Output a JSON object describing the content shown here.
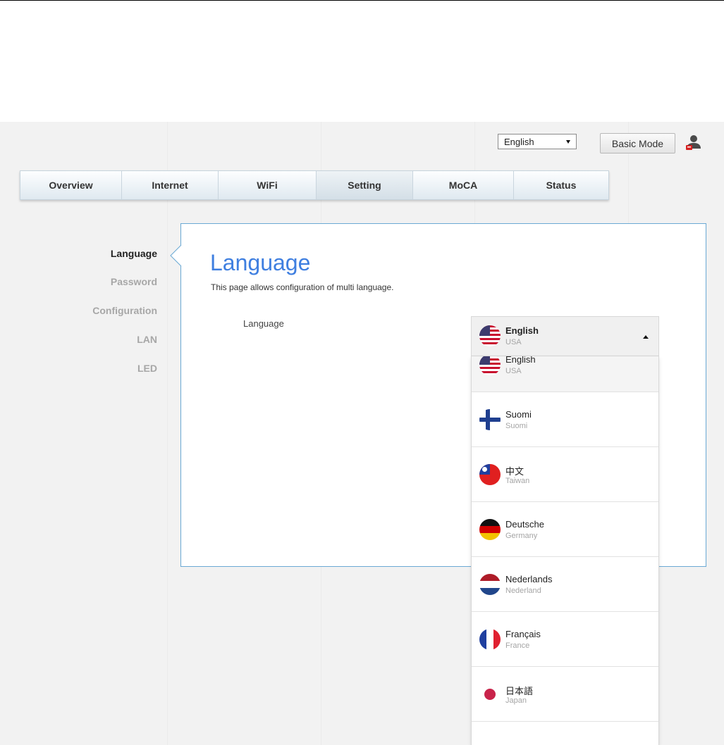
{
  "top": {
    "language_select": {
      "value": "English"
    },
    "basic_mode_label": "Basic Mode"
  },
  "tabs": [
    {
      "label": "Overview"
    },
    {
      "label": "Internet"
    },
    {
      "label": "WiFi"
    },
    {
      "label": "Setting",
      "active": true
    },
    {
      "label": "MoCA"
    },
    {
      "label": "Status"
    }
  ],
  "sidebar": {
    "items": [
      {
        "label": "Language",
        "active": true
      },
      {
        "label": "Password"
      },
      {
        "label": "Configuration"
      },
      {
        "label": "LAN"
      },
      {
        "label": "LED"
      }
    ]
  },
  "main": {
    "title": "Language",
    "description": "This page allows configuration of multi language.",
    "field_label": "Language",
    "selected": {
      "name": "English",
      "region": "USA",
      "flag": "us-flag"
    },
    "options": [
      {
        "name": "English",
        "region": "USA",
        "flag": "us-flag",
        "selected": true
      },
      {
        "name": "Suomi",
        "region": "Suomi",
        "flag": "finland-flag"
      },
      {
        "name": "中文",
        "region": "Taiwan",
        "flag": "taiwan-flag"
      },
      {
        "name": "Deutsche",
        "region": "Germany",
        "flag": "germany-flag"
      },
      {
        "name": "Nederlands",
        "region": "Nederland",
        "flag": "netherlands-flag"
      },
      {
        "name": "Français",
        "region": "France",
        "flag": "france-flag"
      },
      {
        "name": "日本語",
        "region": "Japan",
        "flag": "japan-flag"
      }
    ]
  },
  "colors": {
    "accent_title": "#3f7fe0",
    "panel_border": "#6aa9d4",
    "page_background": "#f2f2f2"
  }
}
